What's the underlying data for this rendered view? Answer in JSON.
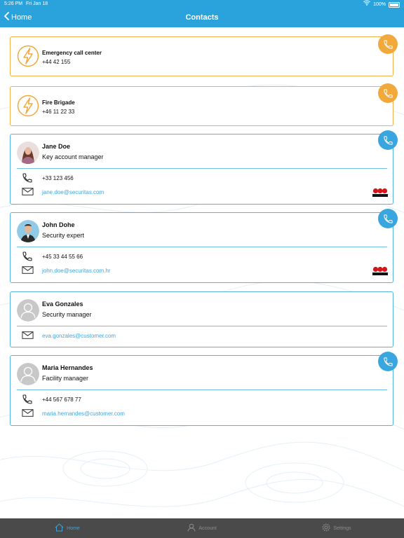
{
  "status": {
    "time": "5:26 PM",
    "date": "Fri Jan 18",
    "battery": "100%"
  },
  "nav": {
    "back_label": "Home",
    "title": "Contacts"
  },
  "emergency": [
    {
      "name": "Emergency call center",
      "phone": "+44 42 155"
    },
    {
      "name": "Fire Brigade",
      "phone": "+46 11 22 33"
    }
  ],
  "people": [
    {
      "name": "Jane Doe",
      "role": "Key account manager",
      "phone": "+33 123 456",
      "email": "jane.doe@securitas.com",
      "logo": "securitas-logo"
    },
    {
      "name": "John Dohe",
      "role": "Security expert",
      "phone": "+45 33 44 55 66",
      "email": "john.doe@securitas.com.hr",
      "logo": "securitas-logo"
    },
    {
      "name": "Eva Gonzales",
      "role": "Security manager",
      "email": "eva.gonzales@customer.com"
    },
    {
      "name": "Maria Hernandes",
      "role": "Facility manager",
      "phone": "+44 567 678 77",
      "email": "maria.hernandes@customer.com"
    }
  ],
  "tabs": [
    {
      "label": "Home",
      "icon": "home-icon",
      "active": true
    },
    {
      "label": "Account",
      "icon": "user-icon",
      "active": false
    },
    {
      "label": "Settings",
      "icon": "gear-icon",
      "active": false
    }
  ],
  "colors": {
    "brand": "#2aa3dd",
    "emergency": "#f2a93b",
    "link": "#3aa6e0",
    "tabbar": "#4a4a4a"
  }
}
